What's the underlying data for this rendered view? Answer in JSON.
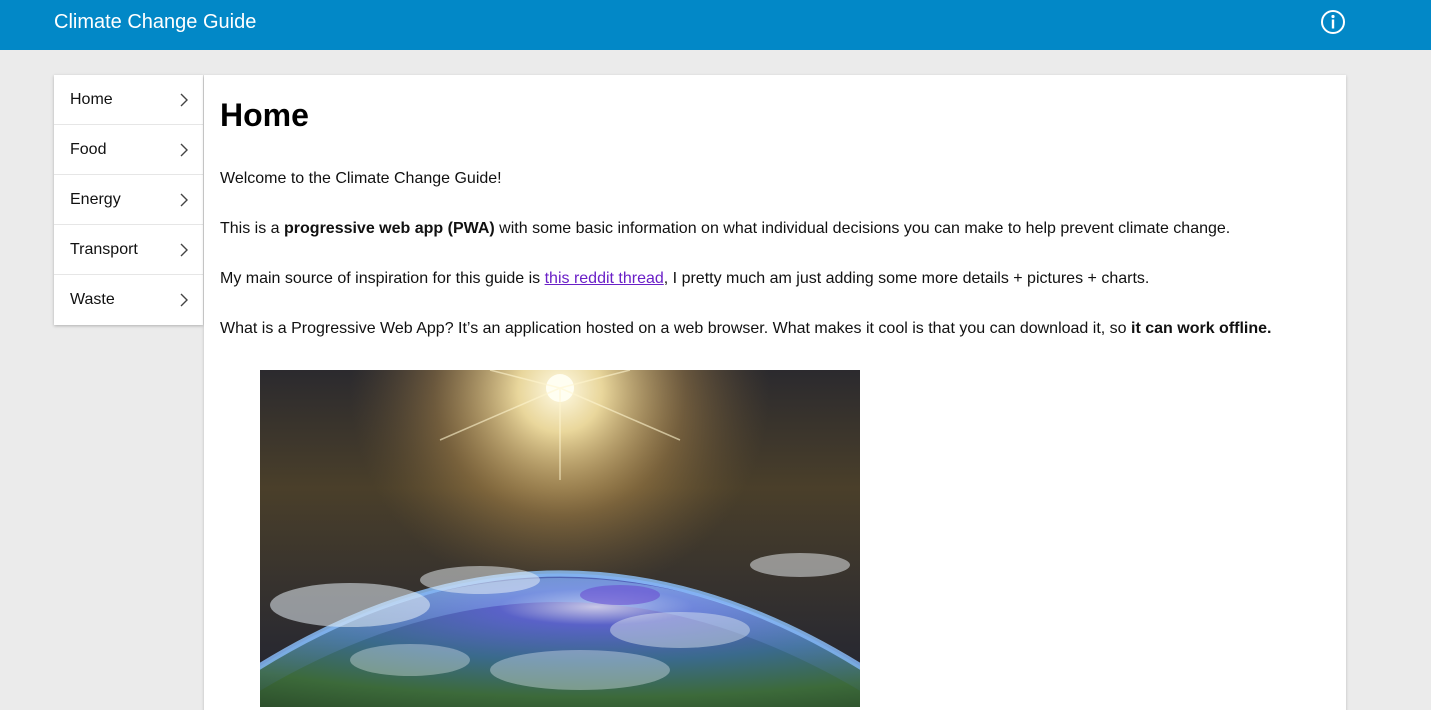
{
  "appbar": {
    "title": "Climate Change Guide",
    "info_icon": "info-circle-icon",
    "color": "#0288c7"
  },
  "sidebar": {
    "items": [
      {
        "label": "Home",
        "icon": "chevron-right-icon"
      },
      {
        "label": "Food",
        "icon": "chevron-right-icon"
      },
      {
        "label": "Energy",
        "icon": "chevron-right-icon"
      },
      {
        "label": "Transport",
        "icon": "chevron-right-icon"
      },
      {
        "label": "Waste",
        "icon": "chevron-right-icon"
      }
    ]
  },
  "main": {
    "heading": "Home",
    "welcome": "Welcome to the Climate Change Guide!",
    "pwa_intro": {
      "before": "This is a ",
      "bold": "progressive web app (PWA)",
      "after": " with some basic information on what individual decisions you can make to help prevent climate change."
    },
    "inspiration": {
      "before": "My main source of inspiration for this guide is ",
      "link": "this reddit thread",
      "after": ", I pretty much am just adding some more details + pictures + charts."
    },
    "pwa_explain": {
      "before": "What is a Progressive Web App? It’s an application hosted on a web browser. What makes it cool is that you can download it, so ",
      "bold": "it can work offline."
    },
    "link_color": "#6a1fc7",
    "hero_image": "earth-from-space-image"
  }
}
